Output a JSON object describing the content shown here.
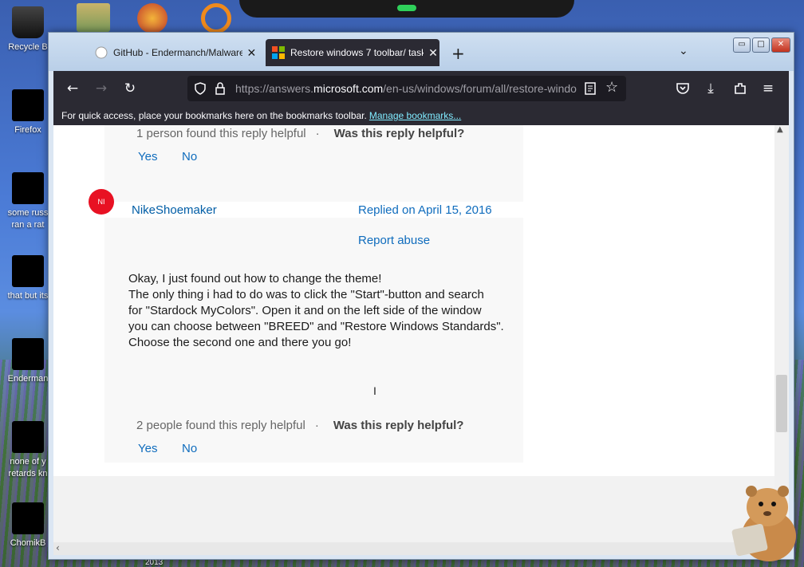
{
  "desktop": {
    "icons": [
      {
        "label": "Recycle B"
      },
      {
        "label": "Firefox"
      },
      {
        "label": "some russ ran a rat"
      },
      {
        "label": "that but its"
      },
      {
        "label": "Enderman"
      },
      {
        "label": "none of y retards kn"
      },
      {
        "label": "ChomikB"
      }
    ],
    "year_text": "2013"
  },
  "browser": {
    "tabs": [
      {
        "label": "GitHub - Endermanch/Malware",
        "close": "✕",
        "active": false
      },
      {
        "label": "Restore windows 7 toolbar/ task",
        "close": "✕",
        "active": true
      }
    ],
    "new_tab": "+",
    "list_tabs": "⌄",
    "window_controls": {
      "minimize": "▭",
      "maximize": "□",
      "close": "✕"
    },
    "url_prefix": "https://answers.",
    "url_domain": "microsoft.com",
    "url_rest": "/en-us/windows/forum/all/restore-windo",
    "bookmarks_text": "For quick access, place your bookmarks here on the bookmarks toolbar.",
    "manage_bookmarks": "Manage bookmarks..."
  },
  "thread": {
    "prev_reply": {
      "helpful_count": "1 person found this reply helpful",
      "separator": "·",
      "helpful_question": "Was this reply helpful?",
      "yes": "Yes",
      "no": "No"
    },
    "reply": {
      "avatar": "NI",
      "author": "NikeShoemaker",
      "replied": "Replied on April 15, 2016",
      "report": "Report abuse",
      "body": [
        "Okay, I just found out how to change the theme!",
        "The only thing i had to do was to click the \"Start\"-button and search",
        "for \"Stardock MyColors\". Open it and on the left side of the window",
        "you can choose between \"BREED\" and \"Restore Windows Standards\".",
        "Choose the second one and there you go!"
      ],
      "helpful_count": "2 people found this reply helpful",
      "separator": "·",
      "helpful_question": "Was this reply helpful?",
      "yes": "Yes",
      "no": "No"
    }
  },
  "colors": {
    "accent": "#0f6cbd",
    "avatar": "#e81123",
    "toolbar": "#2b2a33"
  }
}
